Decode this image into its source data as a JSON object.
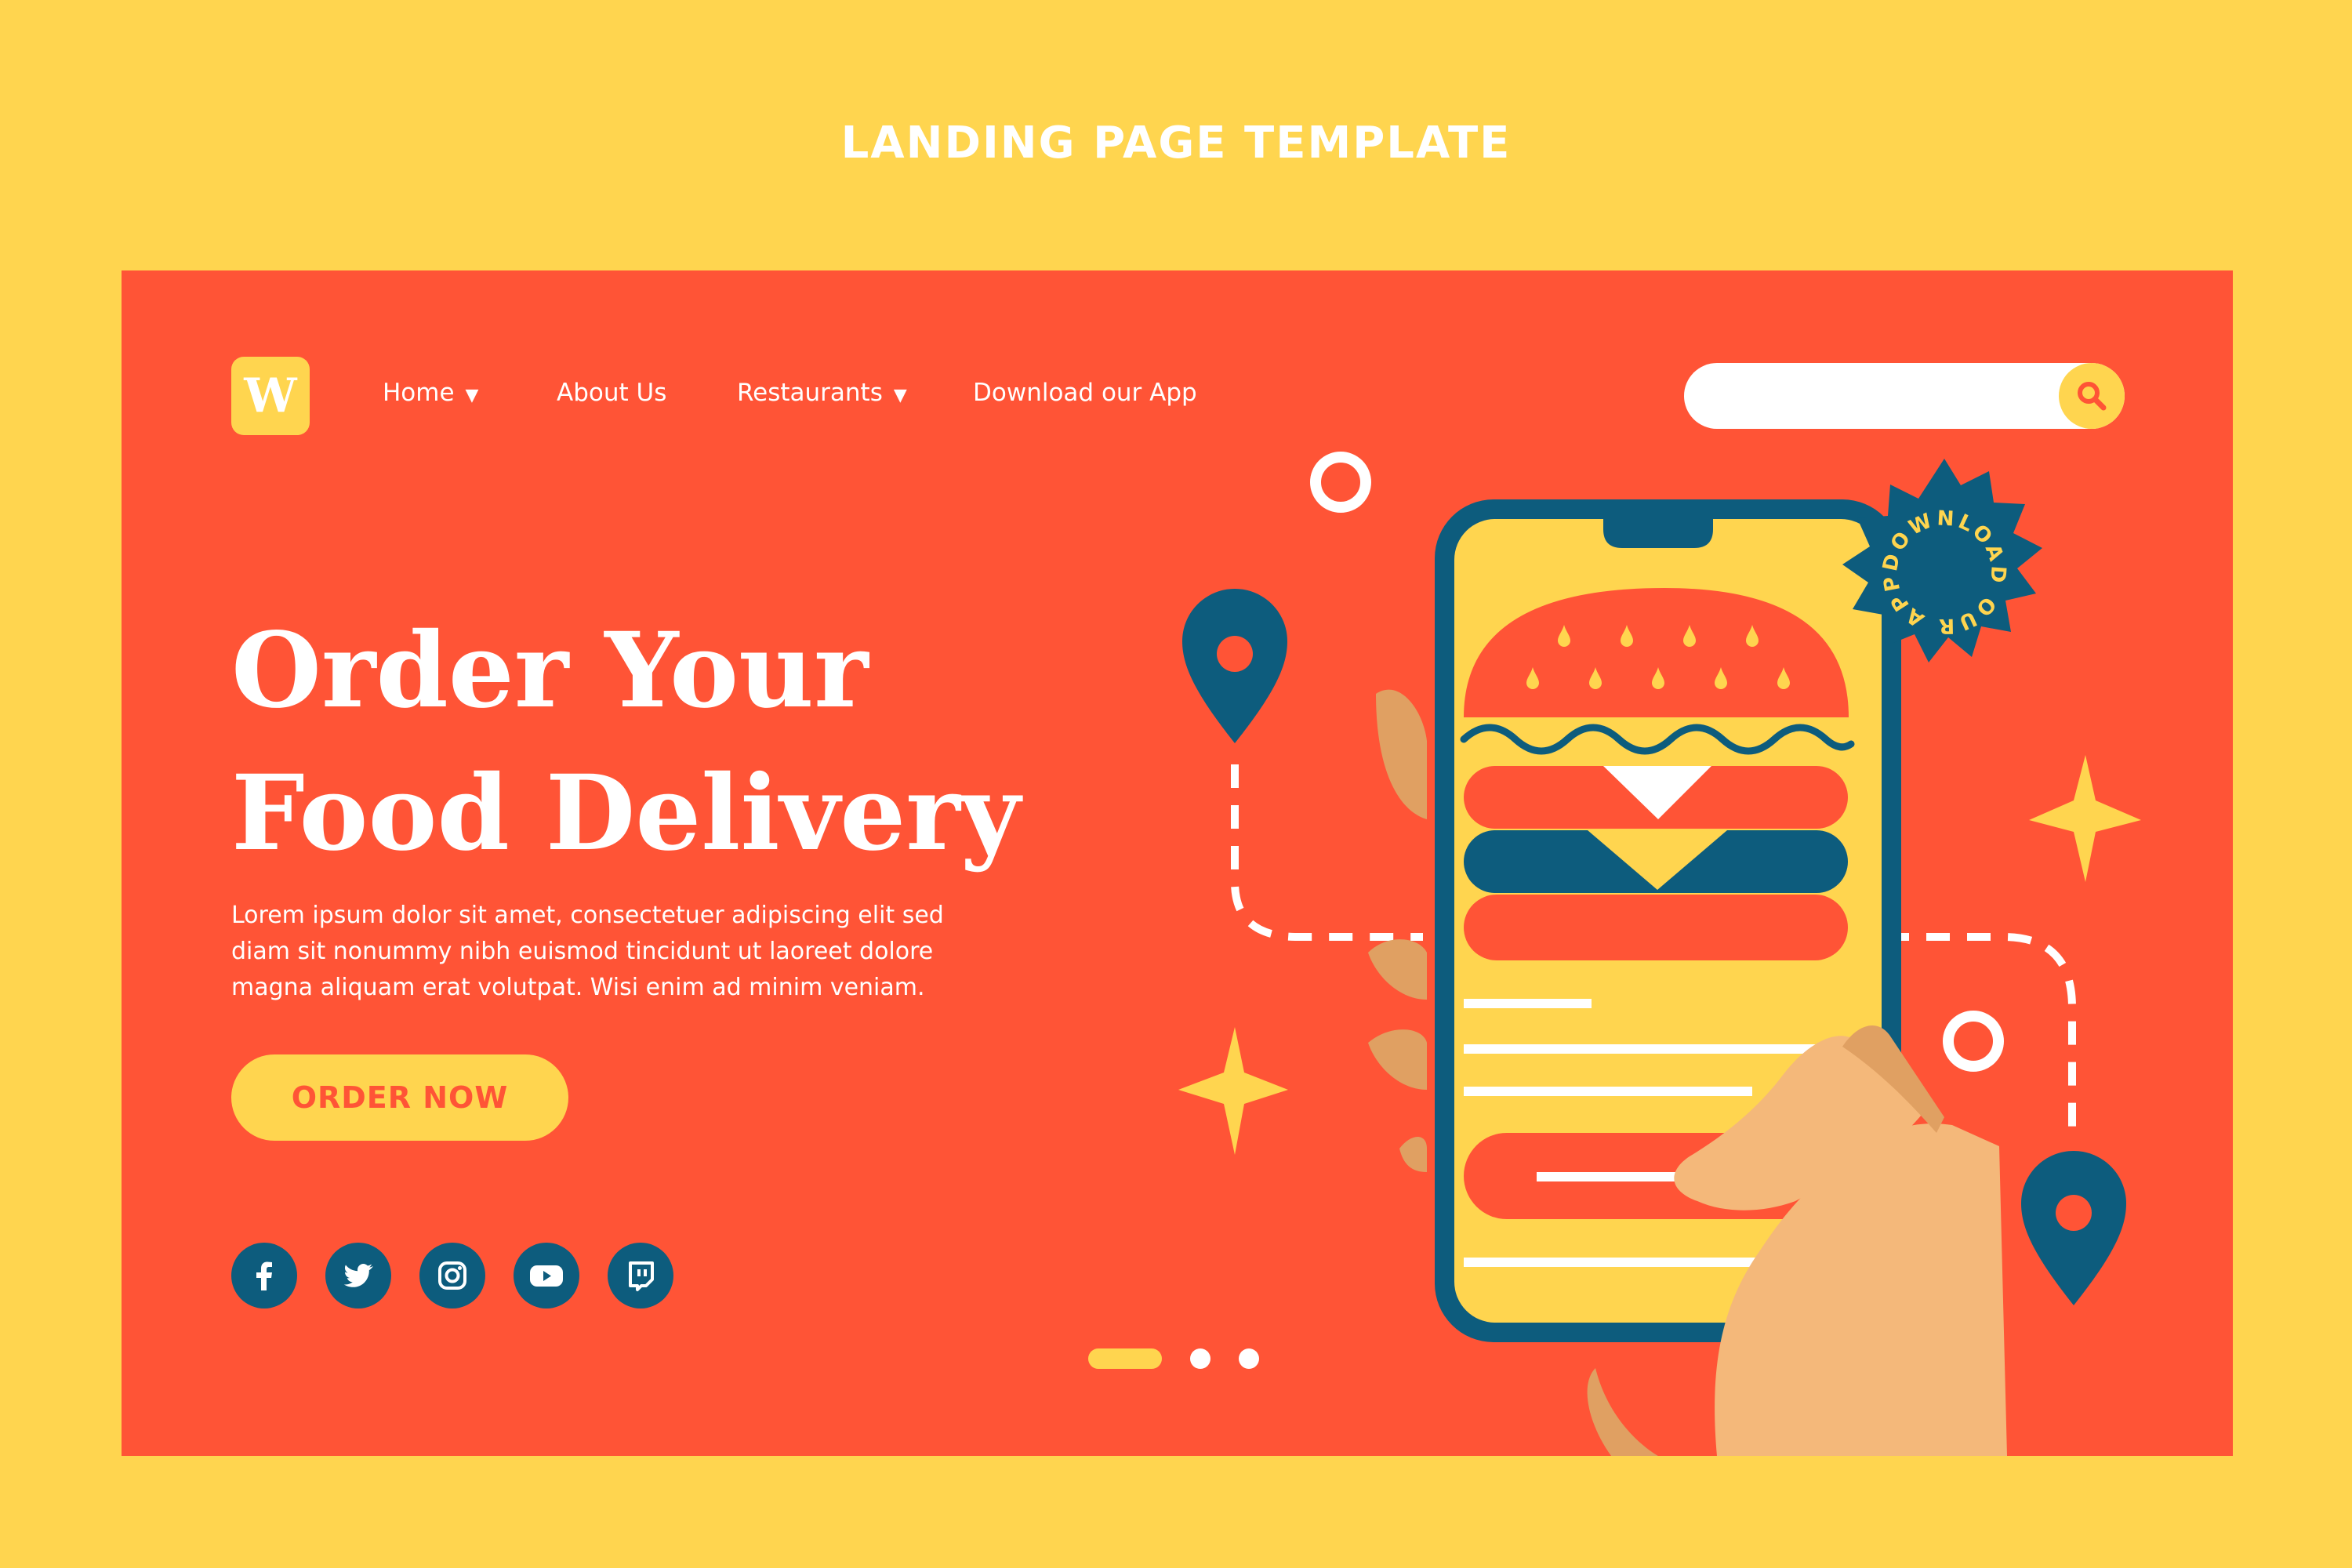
{
  "page": {
    "title": "LANDING PAGE TEMPLATE"
  },
  "logo": {
    "letter": "W"
  },
  "nav": {
    "items": [
      {
        "label": "Home",
        "has_dropdown": true
      },
      {
        "label": "About Us",
        "has_dropdown": false
      },
      {
        "label": "Restaurants",
        "has_dropdown": true
      },
      {
        "label": "Download our App",
        "has_dropdown": false
      }
    ]
  },
  "search": {
    "placeholder": "",
    "value": "",
    "icon": "search-icon"
  },
  "hero": {
    "headline_line1": "Order Your",
    "headline_line2": "Food Delivery",
    "body": "Lorem ipsum dolor sit amet, consectetuer adipiscing elit sed diam sit nonummy nibh euismod tincidunt ut laoreet dolore magna aliquam erat volutpat. Wisi enim ad minim veniam.",
    "cta_label": "ORDER NOW"
  },
  "badge": {
    "text": "DOWNLOAD OUR APP"
  },
  "socials": [
    "facebook-icon",
    "twitter-icon",
    "instagram-icon",
    "youtube-icon",
    "twitch-icon"
  ],
  "carousel": {
    "total": 3,
    "active": 1
  },
  "colors": {
    "background": "#FFD54F",
    "card": "#FF5436",
    "navy": "#0D5C7D",
    "accent_yellow": "#FFD54F",
    "skin": "#F4B87A",
    "skin_shadow": "#E0A062",
    "white": "#FFFFFF"
  }
}
